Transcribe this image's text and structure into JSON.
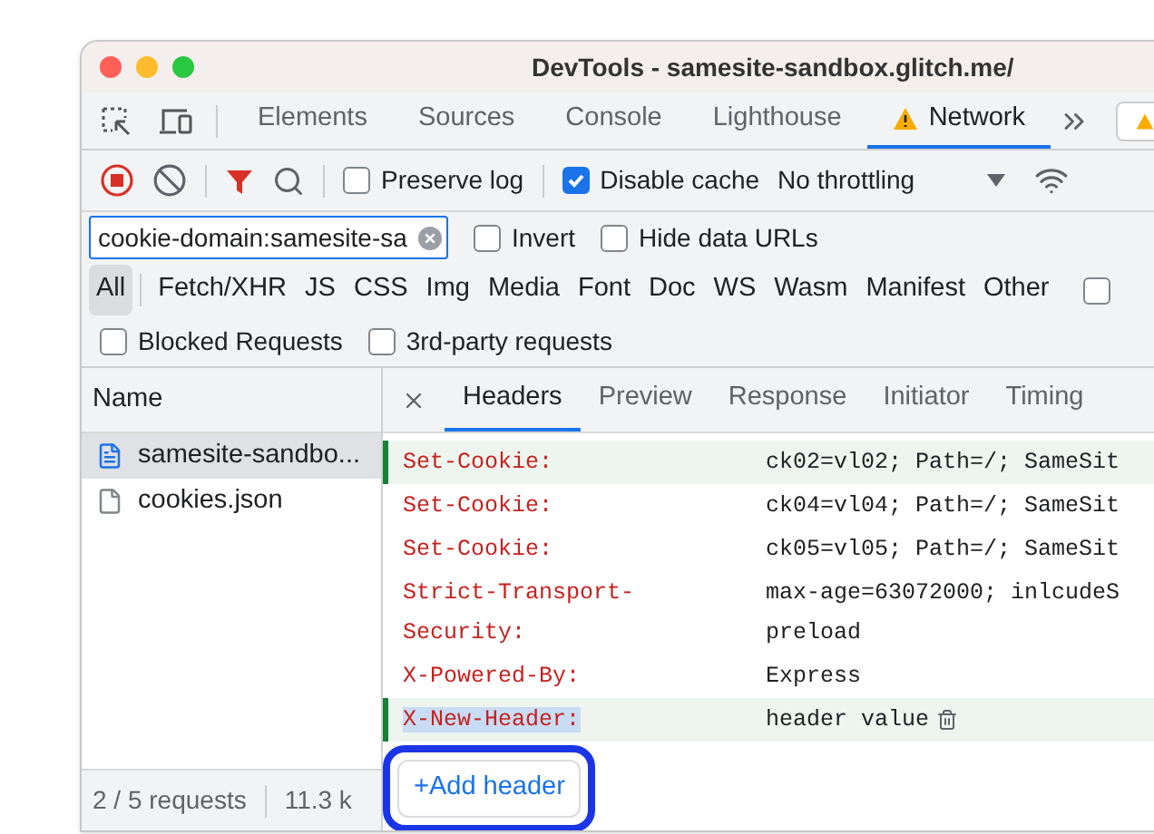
{
  "window": {
    "title": "DevTools - samesite-sandbox.glitch.me/"
  },
  "tabs": [
    {
      "label": "Elements",
      "selected": false,
      "kind": "plain"
    },
    {
      "label": "Sources",
      "selected": false,
      "kind": "plain"
    },
    {
      "label": "Console",
      "selected": false,
      "kind": "plain"
    },
    {
      "label": "Lighthouse",
      "selected": false,
      "kind": "plain"
    },
    {
      "label": "Network",
      "selected": true,
      "kind": "warning"
    }
  ],
  "toolbar": {
    "preserve_log": {
      "label": "Preserve log",
      "checked": false
    },
    "disable_cache": {
      "label": "Disable cache",
      "checked": true
    },
    "throttling": "No throttling"
  },
  "filter": {
    "value": "cookie-domain:samesite-sa",
    "invert": {
      "label": "Invert",
      "checked": false
    },
    "hide_data_urls": {
      "label": "Hide data URLs",
      "checked": false
    }
  },
  "type_filters": [
    {
      "label": "All",
      "selected": true
    },
    {
      "label": "Fetch/XHR",
      "selected": false
    },
    {
      "label": "JS",
      "selected": false
    },
    {
      "label": "CSS",
      "selected": false
    },
    {
      "label": "Img",
      "selected": false
    },
    {
      "label": "Media",
      "selected": false
    },
    {
      "label": "Font",
      "selected": false
    },
    {
      "label": "Doc",
      "selected": false
    },
    {
      "label": "WS",
      "selected": false
    },
    {
      "label": "Wasm",
      "selected": false
    },
    {
      "label": "Manifest",
      "selected": false
    },
    {
      "label": "Other",
      "selected": false
    }
  ],
  "type_row_checkbox": {
    "checked": false
  },
  "extra_filters": [
    {
      "label": "Blocked Requests",
      "checked": false
    },
    {
      "label": "3rd-party requests",
      "checked": false
    }
  ],
  "requests": {
    "column": "Name",
    "rows": [
      {
        "name": "samesite-sandbo...",
        "selected": true,
        "kind": "document"
      },
      {
        "name": "cookies.json",
        "selected": false,
        "kind": "file"
      }
    ]
  },
  "status_bar": [
    "2 / 5 requests",
    "11.3 k"
  ],
  "detail_tabs": [
    {
      "label": "Headers",
      "selected": true
    },
    {
      "label": "Preview",
      "selected": false
    },
    {
      "label": "Response",
      "selected": false
    },
    {
      "label": "Initiator",
      "selected": false
    },
    {
      "label": "Timing",
      "selected": false
    }
  ],
  "headers": [
    {
      "name": "Set-Cookie:",
      "value_lines": [
        "ck02=vl02; Path=/; SameSit"
      ],
      "modified": true,
      "name_highlighted": false,
      "deletable": false
    },
    {
      "name": "Set-Cookie:",
      "value_lines": [
        "ck04=vl04; Path=/; SameSit"
      ],
      "modified": false,
      "name_highlighted": false,
      "deletable": false
    },
    {
      "name": "Set-Cookie:",
      "value_lines": [
        "ck05=vl05; Path=/; SameSit"
      ],
      "modified": false,
      "name_highlighted": false,
      "deletable": false
    },
    {
      "name": "Strict-Transport-Security:",
      "value_lines": [
        "max-age=63072000; inlcudeS",
        "preload"
      ],
      "modified": false,
      "name_highlighted": false,
      "deletable": false
    },
    {
      "name": "X-Powered-By:",
      "value_lines": [
        "Express"
      ],
      "modified": false,
      "name_highlighted": false,
      "deletable": false
    },
    {
      "name": "X-New-Header:",
      "value_lines": [
        "header value"
      ],
      "modified": true,
      "name_highlighted": true,
      "deletable": true
    }
  ],
  "add_header": {
    "label": "+Add header",
    "highlighted": true
  }
}
